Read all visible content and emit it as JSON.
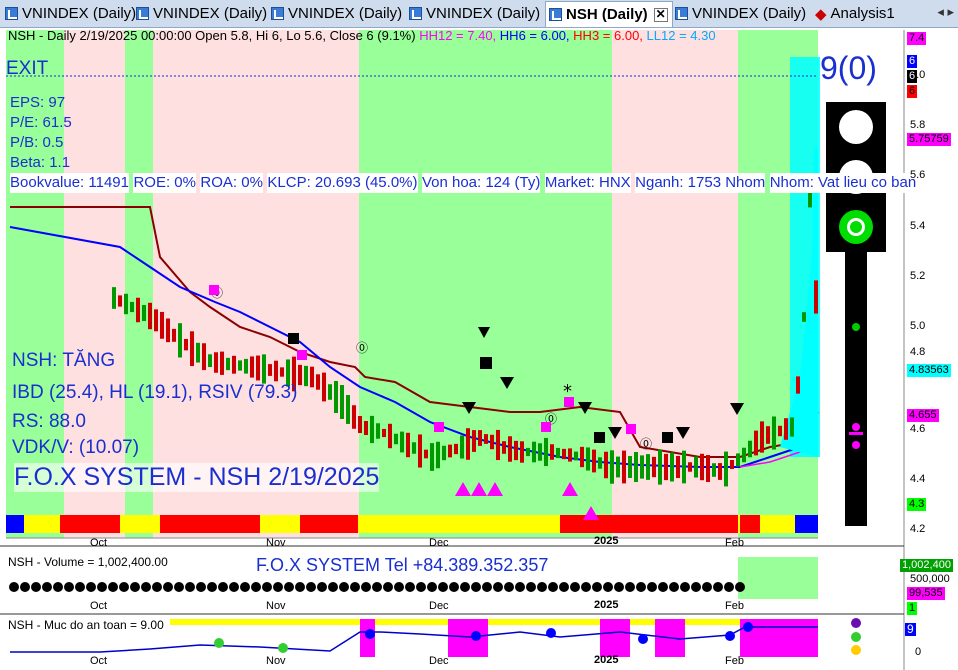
{
  "tabs": [
    {
      "label": "VNINDEX (Daily)",
      "active": false
    },
    {
      "label": "VNINDEX (Daily)",
      "active": false
    },
    {
      "label": "VNINDEX (Daily)",
      "active": false
    },
    {
      "label": "VNINDEX (Daily)",
      "active": false
    },
    {
      "label": "NSH (Daily)",
      "active": true
    },
    {
      "label": "VNINDEX (Daily)",
      "active": false
    },
    {
      "label": "Analysis1",
      "active": false
    }
  ],
  "tab_nav": "◂ ▸",
  "price_header": {
    "main": "NSH - Daily 2/19/2025 00:00:00 Open 5.8, Hi 6, Lo 5.6, Close 6 (9.1%)",
    "hh12": "HH12 = 7.40,",
    "hh6": "HH6 = 6.00,",
    "hh3": "HH3 = 6.00,",
    "ll12": "LL12 = 4.30"
  },
  "exit_label": "EXIT",
  "signal_count": "9(0)",
  "fundamentals": [
    "EPS: 97",
    "P/E: 61.5",
    "P/B: 0.5",
    "Beta: 1.1",
    "Bookvalue: 11491",
    "ROE: 0%",
    "ROA: 0%",
    "KLCP: 20.693 (45.0%)",
    "Von hoa: 124 (Ty)",
    "Market: HNX",
    "Nganh: 1753 Nhom",
    "Nhom: Vat lieu co ban"
  ],
  "status": {
    "trend": "NSH: TĂNG",
    "ibd": "IBD (25.4), HL (19.1), RSIV (79.3)",
    "rs": "RS: 88.0",
    "vdk": "VDK/V:  (10.07)",
    "system": "F.O.X SYSTEM - NSH 2/19/2025"
  },
  "price_axis": {
    "ticks": [
      "6.0",
      "5.8",
      "5.6",
      "5.4",
      "5.2",
      "5.0",
      "4.8",
      "4.6",
      "4.4",
      "4.2"
    ],
    "boxes": [
      {
        "text": "7.4",
        "bg": "#ff00ff",
        "fg": "#000000"
      },
      {
        "text": "6",
        "bg": "#0000ff",
        "fg": "#ffffff"
      },
      {
        "text": "6",
        "bg": "#000000",
        "fg": "#ffffff"
      },
      {
        "text": "6",
        "bg": "#ff0000",
        "fg": "#000000"
      },
      {
        "text": "5.75759",
        "bg": "#ff00ff",
        "fg": "#000000"
      },
      {
        "text": "4.83563",
        "bg": "#00ffff",
        "fg": "#000000"
      },
      {
        "text": "4.655",
        "bg": "#ff00ff",
        "fg": "#000000"
      },
      {
        "text": "4.3",
        "bg": "#00ff00",
        "fg": "#000000"
      }
    ]
  },
  "x_axis": {
    "labels": [
      "Oct",
      "Nov",
      "Dec",
      "2025",
      "Feb"
    ]
  },
  "volume": {
    "header": "NSH - Volume = 1,002,400.00",
    "banner": "F.O.X SYSTEM Tel +84.389.352.357",
    "ticks": [
      "500,000"
    ],
    "boxes": [
      {
        "text": "1,002,400",
        "bg": "#00a000",
        "fg": "#ffffff"
      },
      {
        "text": "99,535",
        "bg": "#ff00ff",
        "fg": "#000000"
      },
      {
        "text": "1",
        "bg": "#00ff00",
        "fg": "#000000"
      }
    ]
  },
  "safety": {
    "header": "NSH - Muc do an toan = 9.00",
    "ticks": [
      "0"
    ],
    "boxes": [
      {
        "text": "9",
        "bg": "#0000ff",
        "fg": "#ffffff"
      }
    ]
  },
  "colors": {
    "green_zone": "#99ff99",
    "pink_zone": "#ffe0e0",
    "up_candle": "#009900",
    "down_candle": "#cc0000",
    "ma_brown": "#8b0000",
    "ma_blue": "#0000ff",
    "cyan": "#00ffff",
    "magenta": "#ff00ff",
    "text_blue": "#1a2fd0"
  },
  "traffic_light": {
    "lamps": [
      "off",
      "off",
      "green"
    ]
  }
}
